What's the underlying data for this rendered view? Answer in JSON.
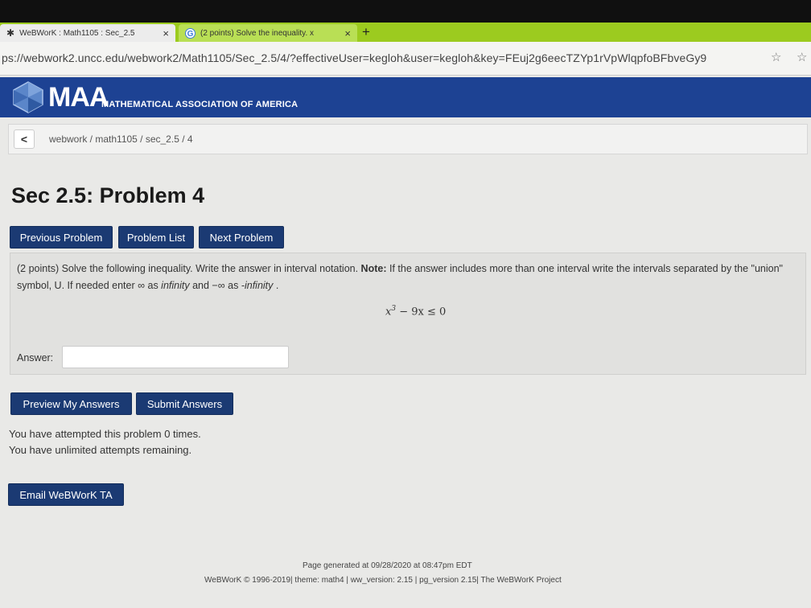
{
  "browser": {
    "tabs": [
      {
        "label": "WeBWorK : Math1105 : Sec_2.5"
      },
      {
        "label": "(2 points) Solve the inequality. x"
      }
    ],
    "tab_close": "×",
    "new_tab": "+",
    "url": "ps://webwork2.uncc.edu/webwork2/Math1105/Sec_2.5/4/?effectiveUser=kegloh&user=kegloh&key=FEuj2g6eecTZYp1rVpWlqpfoBFbveGy9",
    "star": "☆"
  },
  "banner": {
    "logo_text": "MAA",
    "subtitle": "MATHEMATICAL ASSOCIATION OF AMERICA",
    "color": "#1d4293"
  },
  "breadcrumb": {
    "back": "<",
    "path": "webwork / math1105 / sec_2.5 / 4"
  },
  "page": {
    "title": "Sec 2.5: Problem 4"
  },
  "nav": {
    "previous": "Previous Problem",
    "list": "Problem List",
    "next": "Next Problem"
  },
  "problem": {
    "intro": "(2 points) Solve the following inequality. Write the answer in interval notation. ",
    "note_label": "Note:",
    "note_text": " If the answer includes more than one interval write the intervals separated by the \"union\" symbol, U. If needed enter ",
    "infinity_symbol": "∞",
    "as_text": " as ",
    "infinity_word": "infinity",
    "and_text": " and ",
    "neg_infinity_symbol": "−∞",
    "as_text2": " as ",
    "neg_infinity_word": "-infinity",
    "end": " .",
    "formula_x": "x",
    "formula_exp": "3",
    "formula_rest": " − 9x ≤ 0",
    "answer_label": "Answer:",
    "answer_value": ""
  },
  "actions": {
    "preview": "Preview My Answers",
    "submit": "Submit Answers",
    "email": "Email WeBWorK TA"
  },
  "status": {
    "attempted": "You have attempted this problem 0 times.",
    "remaining": "You have unlimited attempts remaining."
  },
  "footer": {
    "generated": "Page generated at 09/28/2020 at 08:47pm EDT",
    "copyright": "WeBWorK © 1996-2019| theme: math4 | ww_version: 2.15 | pg_version 2.15| The WeBWorK Project"
  }
}
